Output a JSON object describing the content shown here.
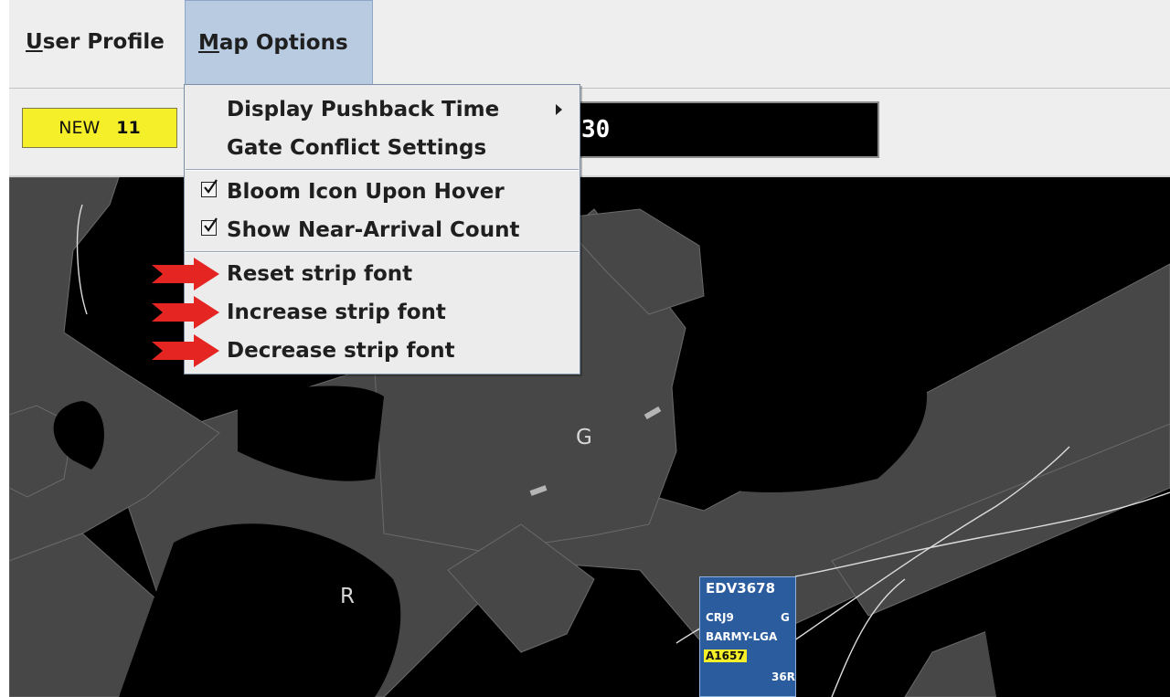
{
  "menubar": {
    "user_profile": {
      "mnemonic": "U",
      "rest": "ser Profile"
    },
    "map_options": {
      "mnemonic": "M",
      "rest": "ap Options"
    }
  },
  "toolbar": {
    "new_label": "NEW",
    "new_count": "11",
    "field_visible_text": "30"
  },
  "map_options_menu": {
    "display_pushback_time": "Display Pushback Time",
    "gate_conflict_settings": "Gate Conflict Settings",
    "bloom_icon_upon_hover": {
      "label": "Bloom Icon Upon Hover",
      "checked": true
    },
    "show_near_arrival_count": {
      "label": "Show Near-Arrival Count",
      "checked": true
    },
    "reset_strip_font": "Reset strip font",
    "increase_strip_font": "Increase strip font",
    "decrease_strip_font": "Decrease strip font"
  },
  "map": {
    "label_g": "G",
    "label_r": "R"
  },
  "flight_strip": {
    "callsign": "EDV3678",
    "type": "CRJ9",
    "category": "G",
    "route": "BARMY-LGA",
    "gate": "A1657",
    "runway": "36R"
  },
  "colors": {
    "menu_background": "#eeeeee",
    "selected_menu": "#b9cbe1",
    "new_badge": "#f5ef2a",
    "pavement": "#474747",
    "map_background": "#000000",
    "strip_background": "#2b5d9e",
    "annotation_arrow": "#e52521"
  },
  "icons": {
    "checkbox": "checkbox-checked-icon",
    "submenu": "submenu-arrow-icon",
    "annotation": "red-arrow-icon"
  }
}
